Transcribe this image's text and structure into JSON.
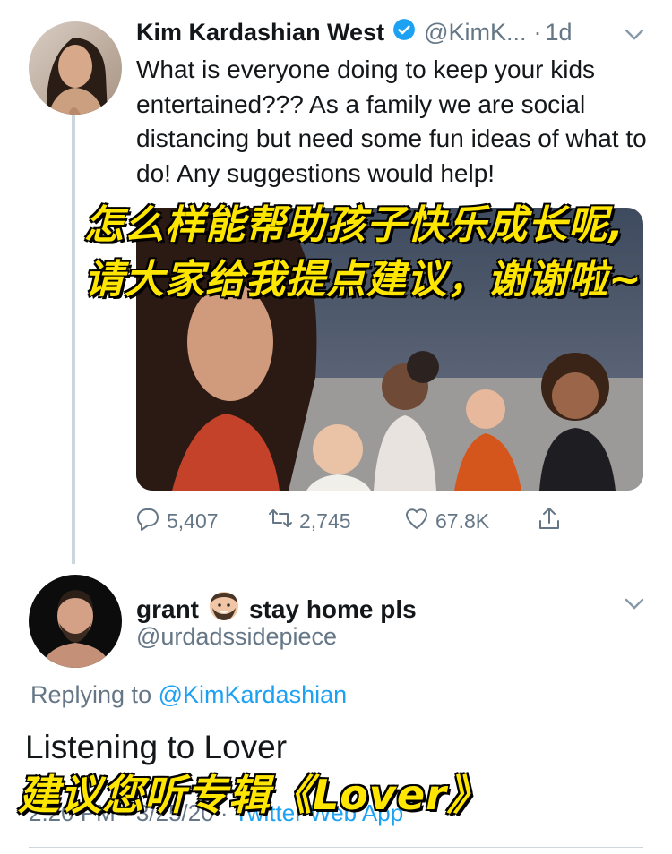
{
  "tweet": {
    "display_name": "Kim Kardashian West",
    "handle": "@KimK...",
    "dot": "·",
    "age": "1d",
    "text": "What is everyone doing to keep your kids entertained??? As a family we are social distancing but need some fun ideas of what to do! Any suggestions would help!",
    "stats": {
      "replies": "5,407",
      "retweets": "2,745",
      "likes": "67.8K"
    }
  },
  "overlay": {
    "line1": "怎么样能帮助孩子快乐成长呢,",
    "line2": "请大家给我提点建议，谢谢啦~",
    "line3": "建议您听专辑《Lover》"
  },
  "reply": {
    "display_name_1": "grant",
    "display_name_2": "stay home pls",
    "handle": "@urdadssidepiece",
    "replying_prefix": "Replying to",
    "replying_to": "@KimKardashian",
    "text": "Listening to Lover",
    "time": "2:20 PM · 3/25/20 ·",
    "app": "Twitter Web App"
  },
  "colors": {
    "accent": "#1da1f2",
    "muted": "#657786",
    "caption": "#ffe600"
  },
  "icons": [
    "verified-badge-icon",
    "chevron-down-icon",
    "reply-icon",
    "retweet-icon",
    "like-icon",
    "share-icon",
    "bearded-man-emoji"
  ]
}
